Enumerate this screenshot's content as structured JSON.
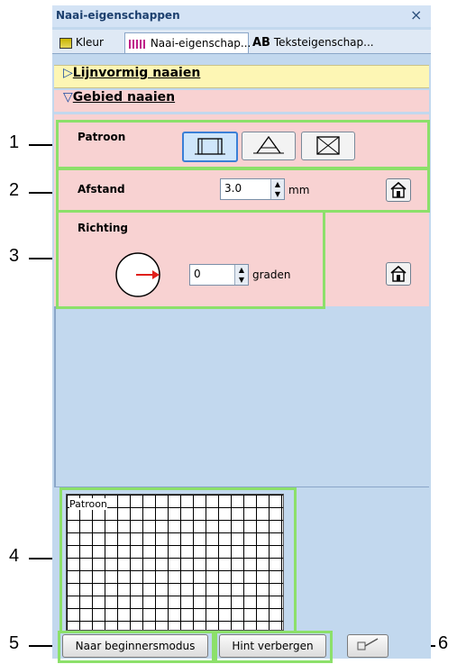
{
  "window": {
    "title": "Naai-eigenschappen",
    "close": "×"
  },
  "tabs": [
    {
      "label": "Kleur",
      "icon": "color-swatch-icon"
    },
    {
      "label": "Naai-eigenschap...",
      "icon": "stitch-icon"
    },
    {
      "label": "Teksteigenschap...",
      "icon": "ab-text-icon",
      "prefix": "AB"
    }
  ],
  "sections": {
    "line": {
      "arrow": "▷",
      "label": "Lijnvormig naaien"
    },
    "area": {
      "arrow": "▽",
      "label": "Gebied naaien"
    }
  },
  "patroon": {
    "label": "Patroon"
  },
  "afstand": {
    "label": "Afstand",
    "value": "3.0",
    "unit": "mm"
  },
  "richting": {
    "label": "Richting",
    "value": "0",
    "unit": "graden"
  },
  "preview": {
    "label": "Patroon"
  },
  "buttons": {
    "beginner": "Naar beginnersmodus",
    "hint": "Hint verbergen"
  },
  "callouts": [
    "1",
    "2",
    "3",
    "4",
    "5",
    "6"
  ],
  "colors": {
    "pink": "#f8d2d2",
    "yellow": "#fdf6b4",
    "panel": "#c2d8ee",
    "callout": "#8ce06a"
  }
}
